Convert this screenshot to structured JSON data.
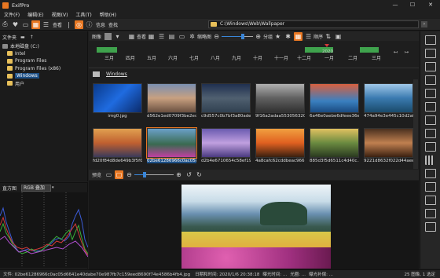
{
  "window": {
    "title": "ExifPro",
    "min": "—",
    "max": "☐",
    "close": "✕"
  },
  "menu": [
    "文件(F)",
    "编辑(E)",
    "视图(V)",
    "工具(T)",
    "帮助(H)"
  ],
  "toolbar": {
    "view_label": "查看",
    "info_label": "信息",
    "find_label": "查找",
    "path": "C:\\Windows\\Web\\Wallpaper"
  },
  "left_panel": {
    "header": "文件夹",
    "tree": [
      {
        "label": "本地磁盘 (C:)",
        "selected": false
      },
      {
        "label": "Intel",
        "selected": false
      },
      {
        "label": "Program Files",
        "selected": false
      },
      {
        "label": "Program Files (x86)",
        "selected": false
      },
      {
        "label": "Windows",
        "selected": true
      },
      {
        "label": "用户",
        "selected": false
      }
    ]
  },
  "histogram": {
    "label": "直方图",
    "mode": "RGB 叠加"
  },
  "timeline": {
    "label": "图像",
    "view_label": "查看",
    "thumb_label": "缩略图",
    "group_label": "分组",
    "order_label": "顺序",
    "year": "2020",
    "months": [
      "三月",
      "四月",
      "五月",
      "六月",
      "七月",
      "八月",
      "九月",
      "十月",
      "十一月",
      "十二月",
      "一月",
      "二月",
      "三月"
    ]
  },
  "breadcrumb": {
    "folder": "Windows"
  },
  "thumbnails": [
    {
      "name": "img0.jpg",
      "selected": false
    },
    {
      "name": "d562e1ed0709f3be2ec0...",
      "selected": false
    },
    {
      "name": "c9d557c0b7bf3a80ade0...",
      "selected": false
    },
    {
      "name": "9f16a2adaa55305632033...",
      "selected": false
    },
    {
      "name": "6a46e0aebe6dfeee36ec...",
      "selected": false
    },
    {
      "name": "474a94e3e445c10d2afe...",
      "selected": false
    },
    {
      "name": "fd20f84d8de649b3f5f0...",
      "selected": false
    },
    {
      "name": "02be61286966c0ac05d6...",
      "selected": true
    },
    {
      "name": "d2b4e6710654c58ef194...",
      "selected": false
    },
    {
      "name": "4a8cafc62cddbeac966...",
      "selected": false
    },
    {
      "name": "885d3f5d6511c4d40c...",
      "selected": false
    },
    {
      "name": "9221d8632f022d44aee...",
      "selected": false
    }
  ],
  "preview": {
    "label": "预览"
  },
  "status": {
    "file": "文件: 02be61286966c0ac05d6641e40dabe70e987fb7c159eed8690f74e4586b4fb4.jpg",
    "date": "日期和时间: 2020/1/6  20:38:18",
    "exposure": "曝光时间: ...",
    "aperture": "光圈: ...",
    "focal": "曝光补偿: ...",
    "count": "25 图像, 1 选定"
  }
}
